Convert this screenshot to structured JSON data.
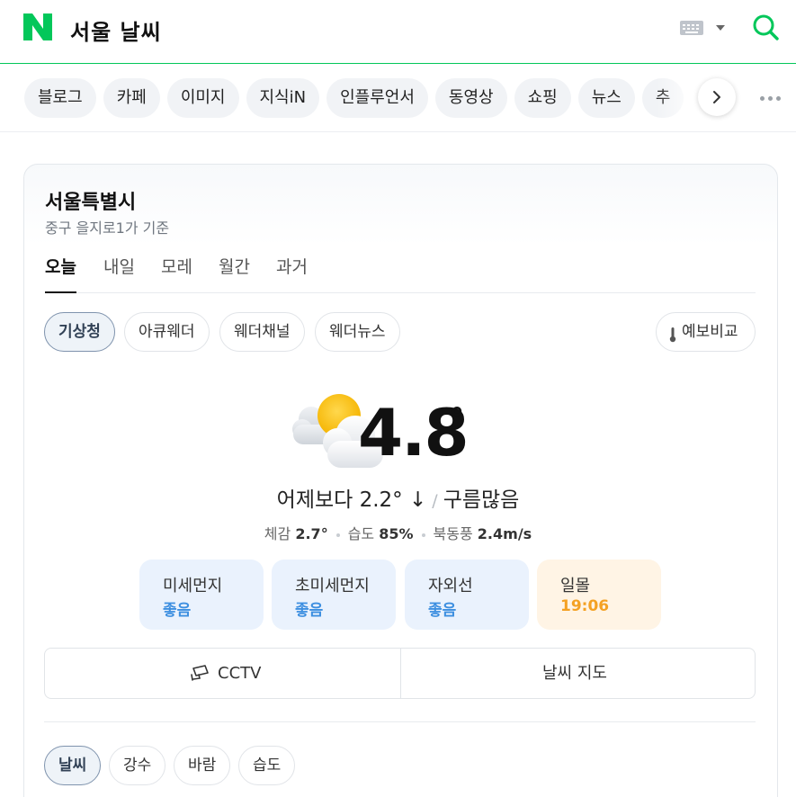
{
  "header": {
    "logo_letter": "N",
    "query": "서울 날씨",
    "brand_color": "#03c75a"
  },
  "categories": [
    "블로그",
    "카페",
    "이미지",
    "지식iN",
    "인플루언서",
    "동영상",
    "쇼핑",
    "뉴스",
    "추"
  ],
  "location": {
    "title": "서울특별시",
    "sub": "중구 을지로1가 기준"
  },
  "days": [
    "오늘",
    "내일",
    "모레",
    "월간",
    "과거"
  ],
  "sources": [
    "기상청",
    "아큐웨더",
    "웨더채널",
    "웨더뉴스"
  ],
  "compare_label": "예보비교",
  "current": {
    "icon": "partly-cloudy-icon",
    "temp": "4.8",
    "deg": "°",
    "vs_yesterday": "어제보다 2.2° ↓",
    "condition": "구름많음",
    "feels_label": "체감",
    "feels_value": "2.7°",
    "humidity_label": "습도",
    "humidity_value": "85%",
    "wind_label": "북동풍",
    "wind_value": "2.4m/s"
  },
  "air": [
    {
      "title": "미세먼지",
      "value": "좋음"
    },
    {
      "title": "초미세먼지",
      "value": "좋음"
    },
    {
      "title": "자외선",
      "value": "좋음"
    },
    {
      "title": "일몰",
      "value": "19:06"
    }
  ],
  "links": {
    "cctv": "CCTV",
    "map": "날씨 지도"
  },
  "bottom_tabs": [
    "날씨",
    "강수",
    "바람",
    "습도"
  ]
}
